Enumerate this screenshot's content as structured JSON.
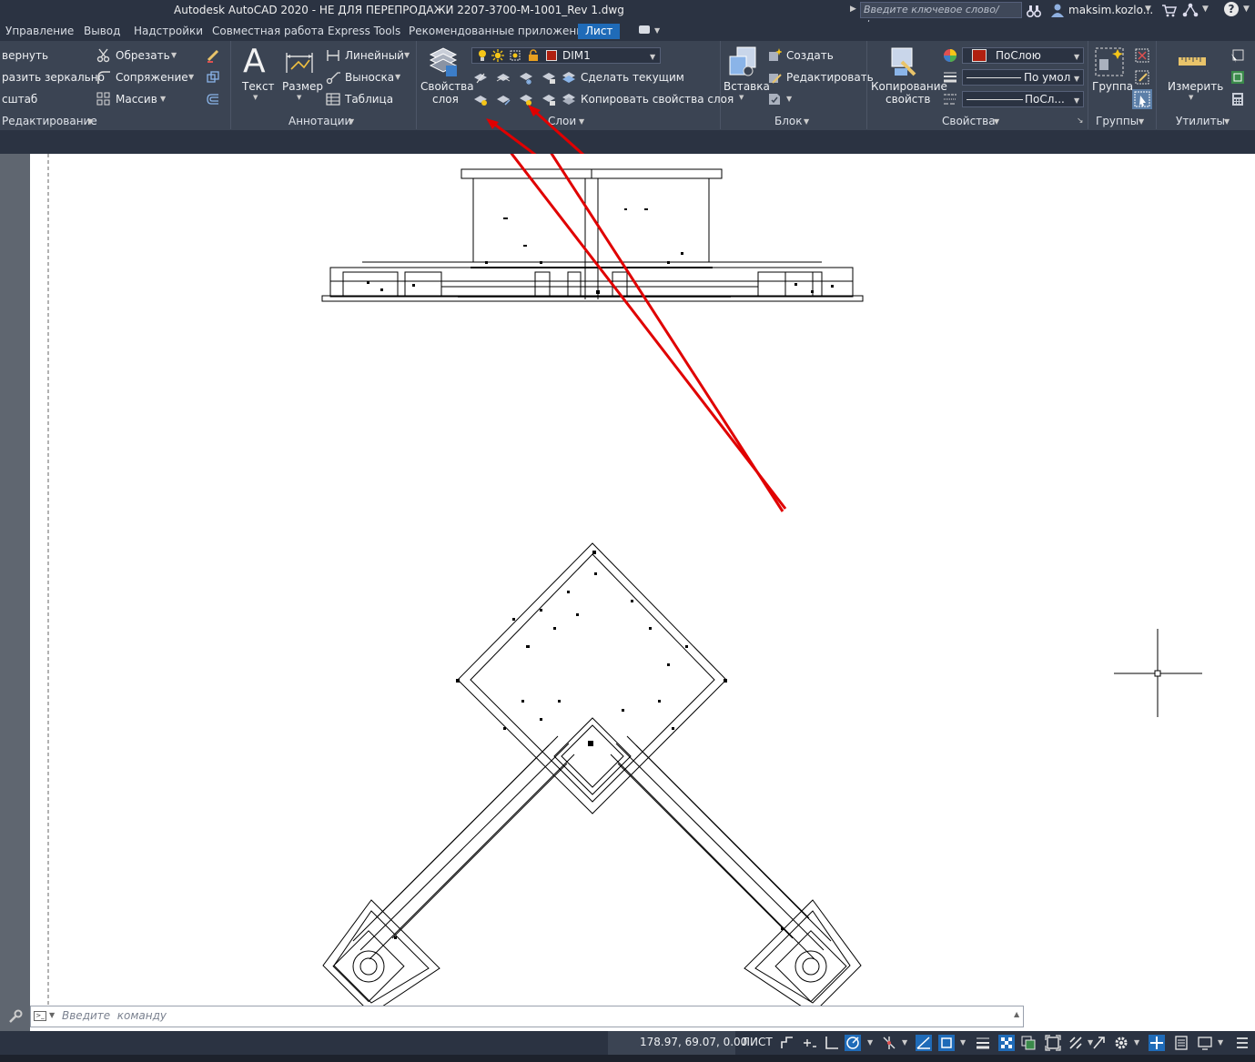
{
  "title_bar": {
    "title": "Autodesk AutoCAD 2020 - НЕ ДЛЯ ПЕРЕПРОДАЖИ    2207-3700-M-1001_Rev 1.dwg",
    "search_placeholder": "Введите ключевое слово/фразу",
    "user": "maksim.kozlo...",
    "help": "?"
  },
  "ribbon_tabs": [
    "Управление",
    "Вывод",
    "Надстройки",
    "Совместная работа",
    "Express Tools",
    "Рекомендованные приложения",
    "Лист"
  ],
  "ribbon": {
    "modify": {
      "items": [
        "вернуть",
        "разить зеркально",
        "сштаб",
        "Обрезать",
        "Сопряжение",
        "Массив"
      ],
      "title": "Редактирование"
    },
    "annotation": {
      "text": "Текст",
      "dimension": "Размер",
      "linear": "Линейный",
      "leader": "Выноска",
      "table": "Таблица",
      "title": "Аннотации"
    },
    "layers": {
      "properties": [
        "Свойства",
        "слоя"
      ],
      "current_layer": "DIM1",
      "make_current": "Сделать текущим",
      "match_layer": "Копировать свойства слоя",
      "title": "Слои"
    },
    "block": {
      "insert": "Вставка",
      "create": "Создать",
      "edit": "Редактировать",
      "title": "Блок"
    },
    "properties": {
      "match": [
        "Копирование",
        "свойств"
      ],
      "color": "ПоСлою",
      "lineweight": "По умол",
      "linetype": "ПоСл...",
      "title": "Свойства"
    },
    "groups": {
      "group": "Группа",
      "title": "Группы"
    },
    "utilities": {
      "measure": "Измерить",
      "title": "Утилиты"
    }
  },
  "command_line": {
    "placeholder": "Введите  команду"
  },
  "status_bar": {
    "coords": "178.97, 69.07, 0.00",
    "space": "ЛИСТ"
  },
  "colors": {
    "annotation_arrows": "#e00000",
    "layer_color_swatch": "#b02010",
    "active_tab": "#1f6bb8"
  }
}
